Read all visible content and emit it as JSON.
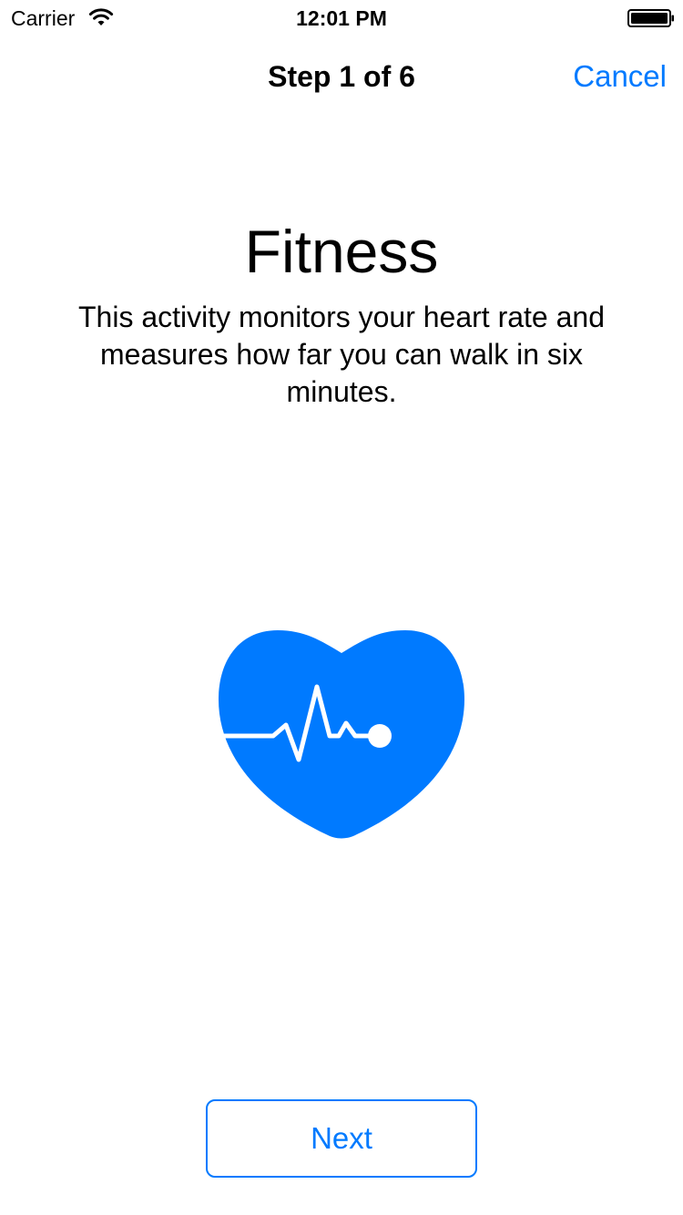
{
  "colors": {
    "accent": "#007aff",
    "text": "#000000",
    "background": "#ffffff"
  },
  "status_bar": {
    "carrier": "Carrier",
    "time": "12:01 PM",
    "wifi_icon": "wifi-icon",
    "battery_icon": "battery-full-icon"
  },
  "nav": {
    "title": "Step 1 of 6",
    "cancel_label": "Cancel"
  },
  "content": {
    "title": "Fitness",
    "description": "This activity monitors your heart rate and measures how far you can walk in six minutes.",
    "illustration_icon": "heart-rate-icon"
  },
  "footer": {
    "next_label": "Next"
  }
}
